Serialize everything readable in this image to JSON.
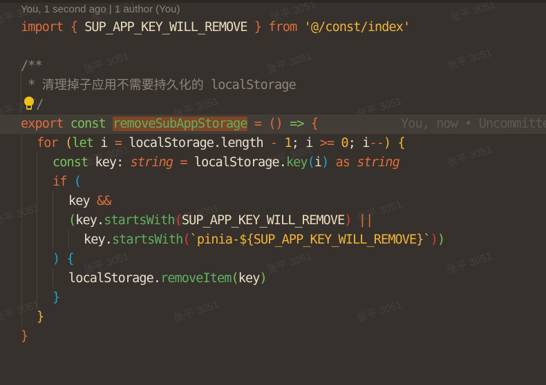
{
  "codelens": {
    "text": "You, 1 second ago | 1 author (You)"
  },
  "blame": {
    "text": "You, now • Uncommitted changes"
  },
  "watermark": {
    "text": "张平 3051"
  },
  "icons": {
    "lightbulb": "lightbulb-icon"
  },
  "code": {
    "line1": {
      "import": "import",
      "open_brace": "{",
      "name": "SUP_APP_KEY_WILL_REMOVE",
      "close_brace": "}",
      "from": "from",
      "path": "'@/const/index'"
    },
    "line3": {
      "text": "/**"
    },
    "line4": {
      "star": " * ",
      "zh": "清理掉子应用不需要持久化的",
      "en": " localStorage"
    },
    "line5": {
      "text": " /"
    },
    "line6": {
      "export": "export",
      "const": "const",
      "fn_name": "removeSubAppStorage",
      "eq": "=",
      "parens": "()",
      "arrow": "=>",
      "brace": "{"
    },
    "line7": {
      "for": "for",
      "lp": "(",
      "let": "let",
      "i": "i",
      "eq": "=",
      "ls": "localStorage.length",
      "minus": "-",
      "one": "1",
      "semi1": ";",
      "i2": "i",
      "gte": ">=",
      "zero": "0",
      "semi2": ";",
      "i3": "i",
      "dec": "--",
      "rp": ")",
      "brace": "{"
    },
    "line8": {
      "const": "const",
      "key": "key:",
      "type1": "string",
      "eq": "=",
      "ls": "localStorage.",
      "method": "key",
      "lp": "(",
      "arg": "i",
      "rp": ")",
      "as": "as",
      "type2": "string"
    },
    "line9": {
      "if": "if",
      "lp": "("
    },
    "line10": {
      "key": "key",
      "and": "&&"
    },
    "line11": {
      "lp": "(",
      "key": "key.",
      "method": "startsWith",
      "lp2": "(",
      "arg": "SUP_APP_KEY_WILL_REMOVE",
      "rp2": ")",
      "or": "||"
    },
    "line12": {
      "key": "key.",
      "method": "startsWith",
      "lp": "(",
      "tpl": "`pinia-${SUP_APP_KEY_WILL_REMOVE}`",
      "rp": ")",
      "rp2": ")"
    },
    "line13": {
      "rp": ")",
      "brace": "{"
    },
    "line14": {
      "ls": "localStorage.",
      "method": "removeItem",
      "lp": "(",
      "arg": "key",
      "rp": ")"
    },
    "line15": {
      "brace": "}"
    },
    "line16": {
      "brace": "}"
    },
    "line17": {
      "brace": "}"
    }
  }
}
